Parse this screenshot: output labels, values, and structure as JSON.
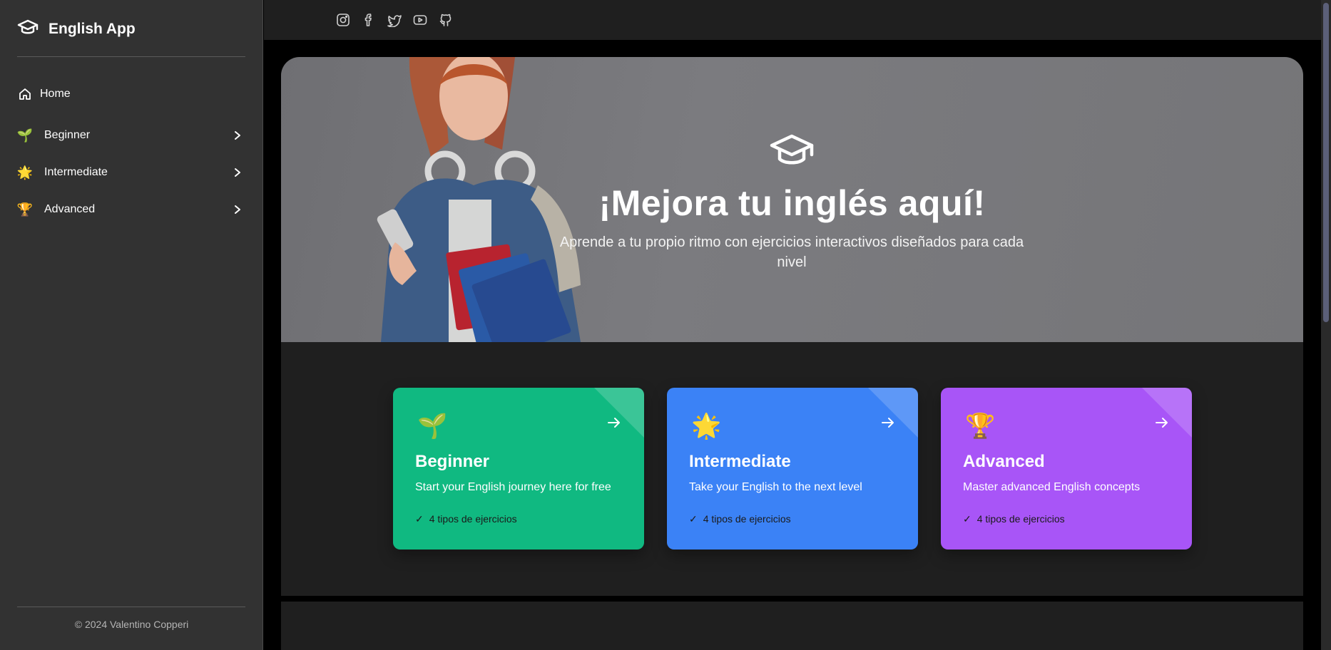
{
  "sidebar": {
    "brand": "English App",
    "items": [
      {
        "label": "Home",
        "icon": "home-icon"
      },
      {
        "label": "Beginner",
        "icon": "seedling-icon",
        "emoji": "🌱"
      },
      {
        "label": "Intermediate",
        "icon": "star-icon",
        "emoji": "🌟"
      },
      {
        "label": "Advanced",
        "icon": "trophy-icon",
        "emoji": "🏆"
      }
    ],
    "footer": "© 2024 Valentino Copperi"
  },
  "socials": [
    "instagram-icon",
    "facebook-icon",
    "twitter-icon",
    "youtube-icon",
    "github-icon"
  ],
  "hero": {
    "title": "¡Mejora tu inglés aquí!",
    "subtitle": "Aprende a tu propio ritmo con ejercicios interactivos diseñados para cada nivel"
  },
  "cards": [
    {
      "title": "Beginner",
      "description": "Start your English journey here for free",
      "feature": "4 tipos de ejercicios",
      "emoji": "🌱",
      "color": "#10b981"
    },
    {
      "title": "Intermediate",
      "description": "Take your English to the next level",
      "feature": "4 tipos de ejercicios",
      "emoji": "🌟",
      "color": "#3b82f6"
    },
    {
      "title": "Advanced",
      "description": "Master advanced English concepts",
      "feature": "4 tipos de ejercicios",
      "emoji": "🏆",
      "color": "#a855f7"
    }
  ],
  "check_mark": "✓"
}
